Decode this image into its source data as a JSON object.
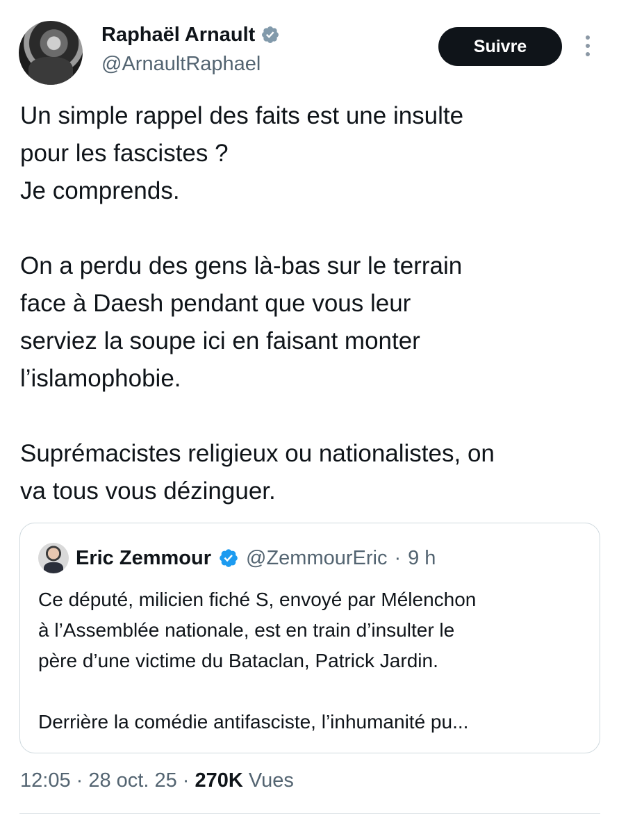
{
  "author": {
    "name": "Raphaël Arnault",
    "handle": "@ArnaultRaphael",
    "verified": true,
    "verified_color": "#829aab"
  },
  "follow_label": "Suivre",
  "tweet": {
    "lines": [
      "Un simple rappel des faits est une insulte",
      "pour les fascistes ?",
      "Je comprends.",
      "",
      "On a perdu des gens là-bas sur le terrain",
      "face à Daesh pendant que vous leur",
      "serviez la soupe ici en faisant monter",
      "l’islamophobie.",
      "",
      "Suprémacistes religieux ou nationalistes, on",
      "va tous vous dézinguer."
    ]
  },
  "quoted": {
    "name": "Eric Zemmour",
    "handle": "@ZemmourEric",
    "separator": "·",
    "time": "9 h",
    "verified_color": "#1d9bf0",
    "lines": [
      "Ce député, milicien fiché S, envoyé par Mélenchon",
      "à l’Assemblée nationale, est en train d’insulter le",
      "père d’une victime du Bataclan, Patrick Jardin.",
      "",
      "Derrière la comédie antifasciste, l’inhumanité pu..."
    ]
  },
  "meta": {
    "time": "12:05",
    "sep1": " · ",
    "date": "28 oct. 25",
    "sep2": " · ",
    "views_count": "270K",
    "views_label": " Vues"
  },
  "icons": {
    "verified": "verified-badge-icon",
    "more": "more-vertical-icon"
  }
}
